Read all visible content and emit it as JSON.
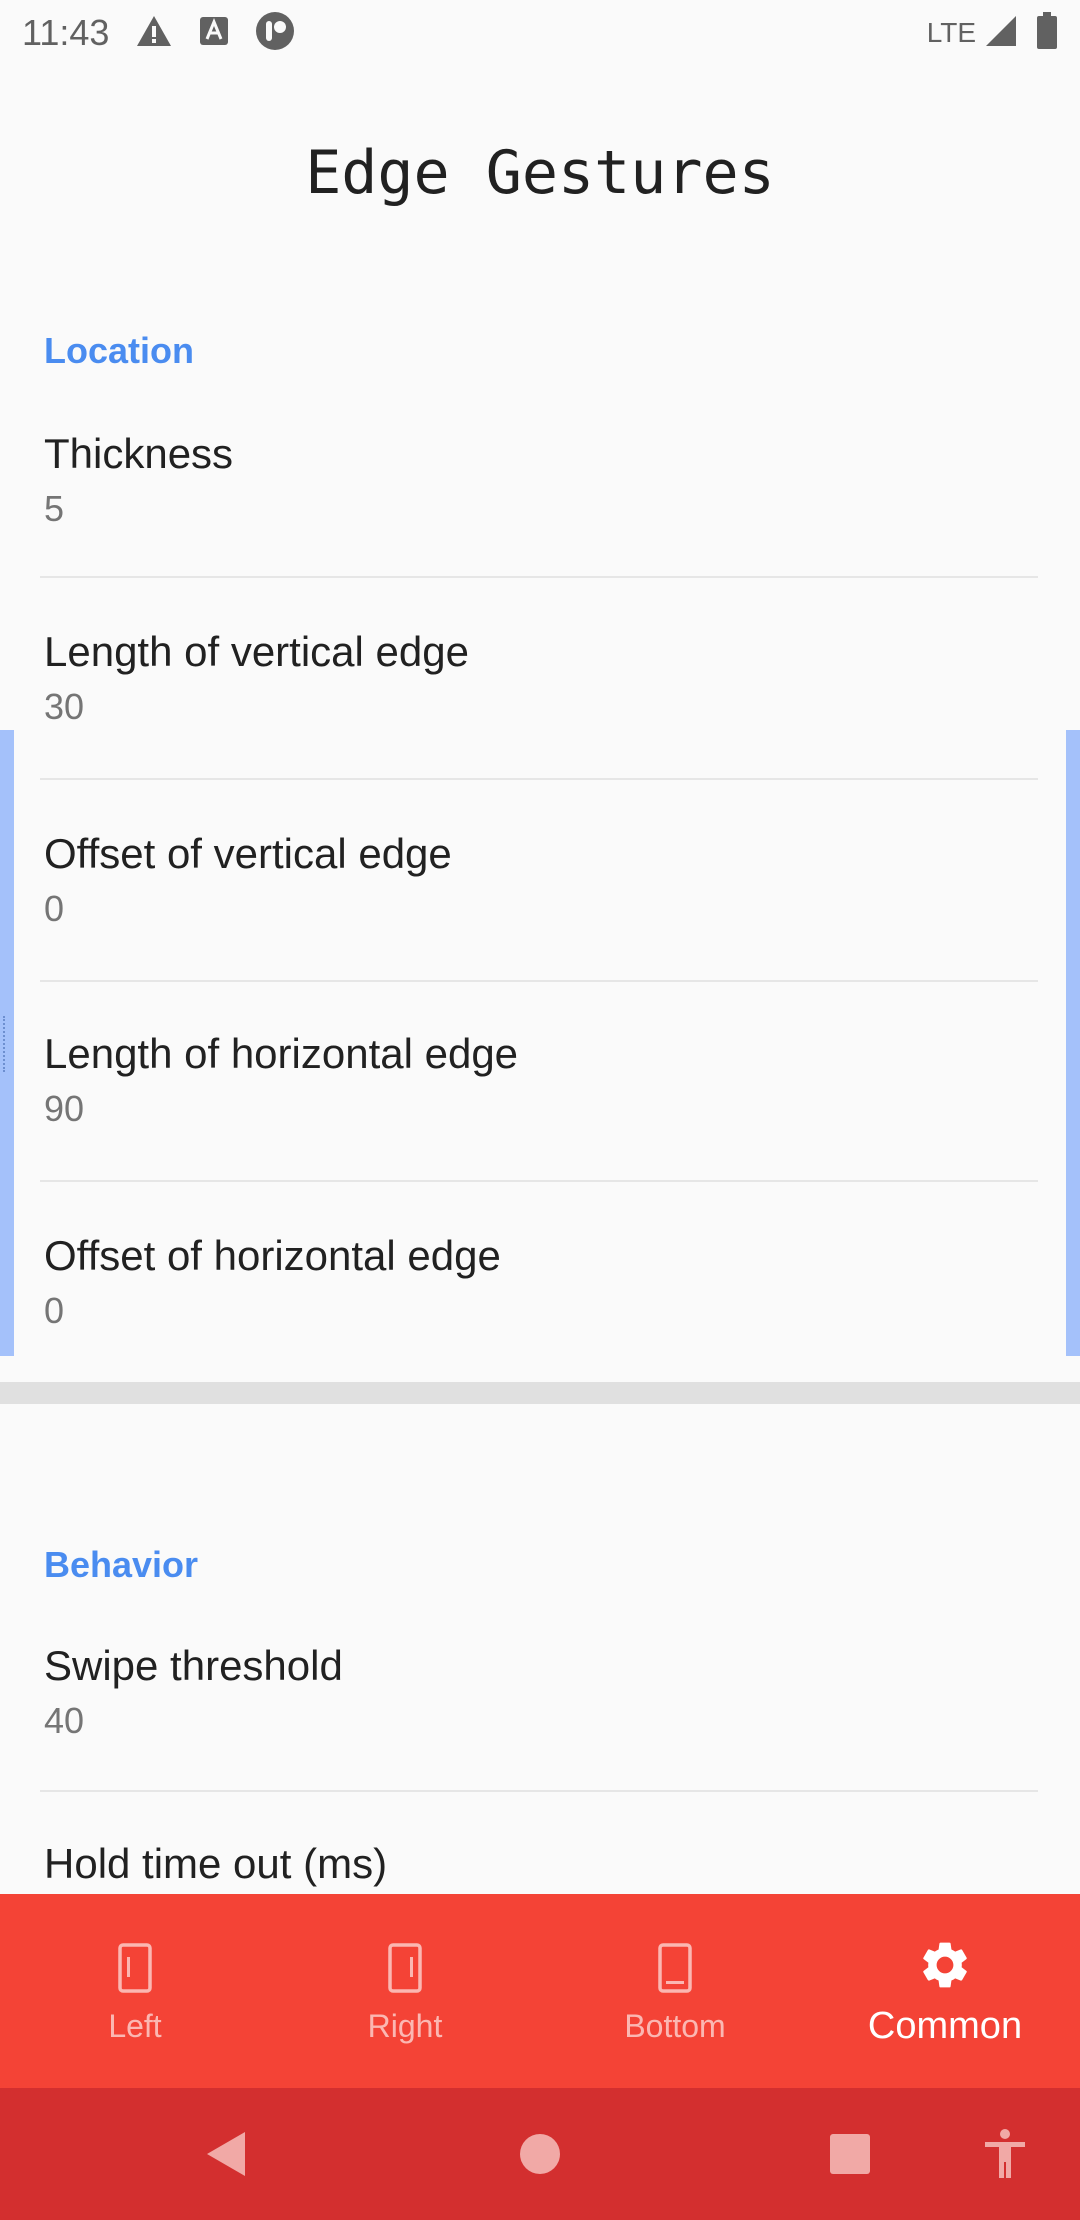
{
  "status_bar": {
    "time": "11:43",
    "network": "LTE",
    "notification_icons": [
      "warning-icon",
      "a-icon",
      "app-icon"
    ]
  },
  "page_title": "Edge Gestures",
  "sections": {
    "location": {
      "header": "Location",
      "items": [
        {
          "title": "Thickness",
          "value": "5"
        },
        {
          "title": "Length of vertical edge",
          "value": "30"
        },
        {
          "title": "Offset of vertical edge",
          "value": "0"
        },
        {
          "title": "Length of horizontal edge",
          "value": "90"
        },
        {
          "title": "Offset of horizontal edge",
          "value": "0"
        }
      ]
    },
    "behavior": {
      "header": "Behavior",
      "items": [
        {
          "title": "Swipe threshold",
          "value": "40"
        },
        {
          "title": "Hold time out (ms)"
        }
      ]
    }
  },
  "bottom_nav": {
    "active": "Common",
    "items": [
      {
        "label": "Left",
        "icon": "phone-left-edge-icon"
      },
      {
        "label": "Right",
        "icon": "phone-right-edge-icon"
      },
      {
        "label": "Bottom",
        "icon": "phone-bottom-edge-icon"
      },
      {
        "label": "Common",
        "icon": "gear-icon"
      }
    ]
  },
  "colors": {
    "accent": "#4a8cf0",
    "nav_bar": "#f44336",
    "system_nav": "#d32f2f",
    "edge_overlay": "#a4c1fa"
  }
}
